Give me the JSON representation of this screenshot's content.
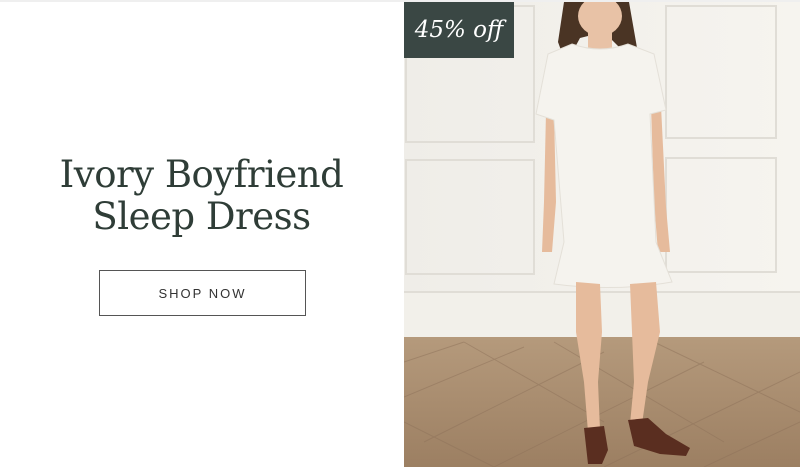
{
  "promo": {
    "title_line1": "Ivory Boyfriend",
    "title_line2": "Sleep Dress",
    "button_label": "SHOP NOW",
    "badge_text": "45% off"
  }
}
